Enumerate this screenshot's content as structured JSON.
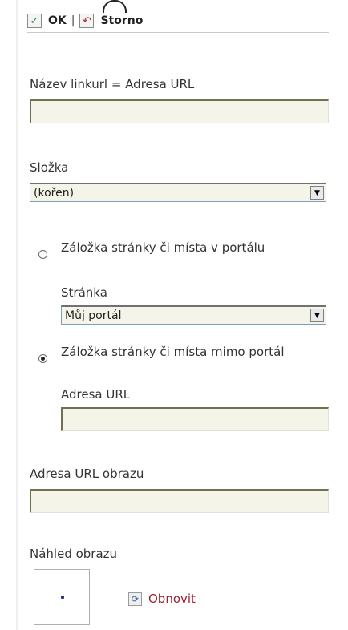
{
  "toolbar": {
    "ok_icon": "check-icon",
    "ok_label": "OK",
    "separator": "|",
    "cancel_icon": "back-arrow-icon",
    "cancel_label": "Storno"
  },
  "form": {
    "name_label": "Název linkurl = Adresa URL",
    "name_value": "",
    "folder_label": "Složka",
    "folder_value": "(kořen)",
    "option_internal_label": "Záložka stránky či místa v portálu",
    "page_label": "Stránka",
    "page_value": "Můj portál",
    "option_external_label": "Záložka stránky či místa mimo portál",
    "url_label": "Adresa URL",
    "url_value": "",
    "image_url_label": "Adresa URL obrazu",
    "image_url_value": "",
    "preview_label": "Náhled obrazu",
    "refresh_icon": "refresh-icon",
    "refresh_label": "Obnovit"
  },
  "colors": {
    "input_background": "#f4f4e8",
    "link_color": "#a0202e"
  }
}
